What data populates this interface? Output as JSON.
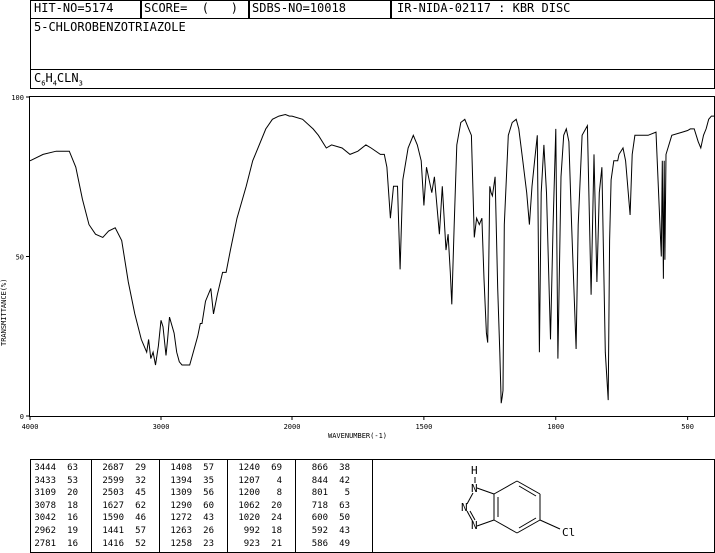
{
  "header": {
    "hit_no": "HIT-NO=5174",
    "score": "SCORE=  (   )",
    "sdbs_no": "SDBS-NO=10018",
    "ir_code": "IR-NIDA-02117 : KBR DISC"
  },
  "compound": {
    "name": "5-CHLOROBENZOTRIAZOLE",
    "formula_parts": [
      "C",
      "6",
      "H",
      "4",
      "CLN",
      "3"
    ]
  },
  "chart_data": {
    "type": "line",
    "xlabel": "WAVENUMBER(-1)",
    "ylabel": "TRANSMITTANCE(%)",
    "xlim": [
      4000,
      400
    ],
    "ylim": [
      0,
      100
    ],
    "x_ticks": [
      "4000",
      "3000",
      "2000",
      "1500",
      "1000",
      "500"
    ],
    "y_ticks": [
      "100",
      "50",
      "0"
    ],
    "series": [
      {
        "points": [
          [
            4000,
            80
          ],
          [
            3900,
            82
          ],
          [
            3800,
            83
          ],
          [
            3700,
            83
          ],
          [
            3650,
            78
          ],
          [
            3600,
            68
          ],
          [
            3550,
            60
          ],
          [
            3500,
            57
          ],
          [
            3444,
            56
          ],
          [
            3400,
            58
          ],
          [
            3350,
            59
          ],
          [
            3300,
            55
          ],
          [
            3250,
            42
          ],
          [
            3200,
            32
          ],
          [
            3150,
            24
          ],
          [
            3130,
            22
          ],
          [
            3109,
            20
          ],
          [
            3095,
            24
          ],
          [
            3078,
            18
          ],
          [
            3060,
            20
          ],
          [
            3042,
            16
          ],
          [
            3020,
            22
          ],
          [
            3000,
            30
          ],
          [
            2985,
            28
          ],
          [
            2962,
            19
          ],
          [
            2950,
            24
          ],
          [
            2935,
            31
          ],
          [
            2900,
            26
          ],
          [
            2880,
            20
          ],
          [
            2860,
            17
          ],
          [
            2840,
            16
          ],
          [
            2810,
            16
          ],
          [
            2781,
            16
          ],
          [
            2760,
            19
          ],
          [
            2720,
            25
          ],
          [
            2700,
            29
          ],
          [
            2687,
            29
          ],
          [
            2660,
            36
          ],
          [
            2620,
            40
          ],
          [
            2599,
            32
          ],
          [
            2570,
            38
          ],
          [
            2530,
            45
          ],
          [
            2503,
            45
          ],
          [
            2470,
            52
          ],
          [
            2420,
            62
          ],
          [
            2350,
            72
          ],
          [
            2300,
            80
          ],
          [
            2200,
            90
          ],
          [
            2150,
            93
          ],
          [
            2100,
            94
          ],
          [
            2050,
            94.5
          ],
          [
            2020,
            94
          ],
          [
            2000,
            94
          ],
          [
            1960,
            93
          ],
          [
            1920,
            90
          ],
          [
            1900,
            88
          ],
          [
            1870,
            84
          ],
          [
            1850,
            85
          ],
          [
            1810,
            84
          ],
          [
            1780,
            82
          ],
          [
            1750,
            83
          ],
          [
            1720,
            85
          ],
          [
            1700,
            84
          ],
          [
            1665,
            82
          ],
          [
            1650,
            82
          ],
          [
            1640,
            78
          ],
          [
            1627,
            62
          ],
          [
            1615,
            72
          ],
          [
            1600,
            72
          ],
          [
            1590,
            46
          ],
          [
            1580,
            74
          ],
          [
            1560,
            84
          ],
          [
            1540,
            88
          ],
          [
            1525,
            85
          ],
          [
            1510,
            80
          ],
          [
            1500,
            66
          ],
          [
            1490,
            78
          ],
          [
            1470,
            70
          ],
          [
            1460,
            75
          ],
          [
            1441,
            57
          ],
          [
            1430,
            72
          ],
          [
            1416,
            52
          ],
          [
            1408,
            57
          ],
          [
            1400,
            45
          ],
          [
            1394,
            35
          ],
          [
            1385,
            60
          ],
          [
            1375,
            85
          ],
          [
            1360,
            92
          ],
          [
            1345,
            93
          ],
          [
            1330,
            90
          ],
          [
            1320,
            88
          ],
          [
            1309,
            56
          ],
          [
            1300,
            62
          ],
          [
            1290,
            60
          ],
          [
            1280,
            62
          ],
          [
            1272,
            43
          ],
          [
            1263,
            26
          ],
          [
            1258,
            23
          ],
          [
            1250,
            72
          ],
          [
            1245,
            70
          ],
          [
            1240,
            69
          ],
          [
            1230,
            75
          ],
          [
            1220,
            40
          ],
          [
            1212,
            20
          ],
          [
            1207,
            4
          ],
          [
            1203,
            6
          ],
          [
            1200,
            8
          ],
          [
            1195,
            60
          ],
          [
            1180,
            88
          ],
          [
            1165,
            92
          ],
          [
            1150,
            93
          ],
          [
            1140,
            90
          ],
          [
            1125,
            80
          ],
          [
            1110,
            70
          ],
          [
            1100,
            60
          ],
          [
            1090,
            72
          ],
          [
            1080,
            80
          ],
          [
            1070,
            88
          ],
          [
            1062,
            20
          ],
          [
            1055,
            70
          ],
          [
            1045,
            85
          ],
          [
            1035,
            70
          ],
          [
            1020,
            24
          ],
          [
            1010,
            60
          ],
          [
            1000,
            90
          ],
          [
            992,
            18
          ],
          [
            980,
            75
          ],
          [
            970,
            88
          ],
          [
            960,
            90
          ],
          [
            950,
            86
          ],
          [
            940,
            60
          ],
          [
            923,
            21
          ],
          [
            915,
            60
          ],
          [
            900,
            88
          ],
          [
            880,
            91
          ],
          [
            866,
            38
          ],
          [
            855,
            82
          ],
          [
            844,
            42
          ],
          [
            835,
            70
          ],
          [
            825,
            78
          ],
          [
            812,
            20
          ],
          [
            801,
            5
          ],
          [
            796,
            55
          ],
          [
            790,
            74
          ],
          [
            780,
            80
          ],
          [
            765,
            80
          ],
          [
            760,
            82
          ],
          [
            745,
            84
          ],
          [
            735,
            80
          ],
          [
            718,
            63
          ],
          [
            710,
            82
          ],
          [
            700,
            88
          ],
          [
            680,
            88
          ],
          [
            650,
            88
          ],
          [
            620,
            89
          ],
          [
            600,
            50
          ],
          [
            596,
            80
          ],
          [
            592,
            43
          ],
          [
            589,
            80
          ],
          [
            586,
            49
          ],
          [
            582,
            82
          ],
          [
            560,
            88
          ],
          [
            520,
            89
          ],
          [
            500,
            89.5
          ],
          [
            490,
            90
          ],
          [
            475,
            90
          ],
          [
            460,
            86
          ],
          [
            450,
            84
          ],
          [
            440,
            88
          ],
          [
            430,
            90
          ],
          [
            420,
            93
          ],
          [
            410,
            94
          ],
          [
            400,
            94
          ]
        ]
      }
    ]
  },
  "peak_table": {
    "columns": [
      [
        [
          "3444",
          "63"
        ],
        [
          "3433",
          "53"
        ],
        [
          "3109",
          "20"
        ],
        [
          "3078",
          "18"
        ],
        [
          "3042",
          "16"
        ],
        [
          "2962",
          "19"
        ],
        [
          "2781",
          "16"
        ]
      ],
      [
        [
          "2687",
          "29"
        ],
        [
          "2599",
          "32"
        ],
        [
          "2503",
          "45"
        ],
        [
          "1627",
          "62"
        ],
        [
          "1590",
          "46"
        ],
        [
          "1441",
          "57"
        ],
        [
          "1416",
          "52"
        ]
      ],
      [
        [
          "1408",
          "57"
        ],
        [
          "1394",
          "35"
        ],
        [
          "1309",
          "56"
        ],
        [
          "1290",
          "60"
        ],
        [
          "1272",
          "43"
        ],
        [
          "1263",
          "26"
        ],
        [
          "1258",
          "23"
        ]
      ],
      [
        [
          "1240",
          "69"
        ],
        [
          "1207",
          "4"
        ],
        [
          "1200",
          "8"
        ],
        [
          "1062",
          "20"
        ],
        [
          "1020",
          "24"
        ],
        [
          "992",
          "18"
        ],
        [
          "923",
          "21"
        ]
      ],
      [
        [
          "866",
          "38"
        ],
        [
          "844",
          "42"
        ],
        [
          "801",
          "5"
        ],
        [
          "718",
          "63"
        ],
        [
          "600",
          "50"
        ],
        [
          "592",
          "43"
        ],
        [
          "586",
          "49"
        ]
      ]
    ]
  },
  "structure": {
    "nh_label": "H",
    "n1_label": "N",
    "n2_label": "N",
    "n3_label": "N",
    "cl_label": "Cl"
  }
}
